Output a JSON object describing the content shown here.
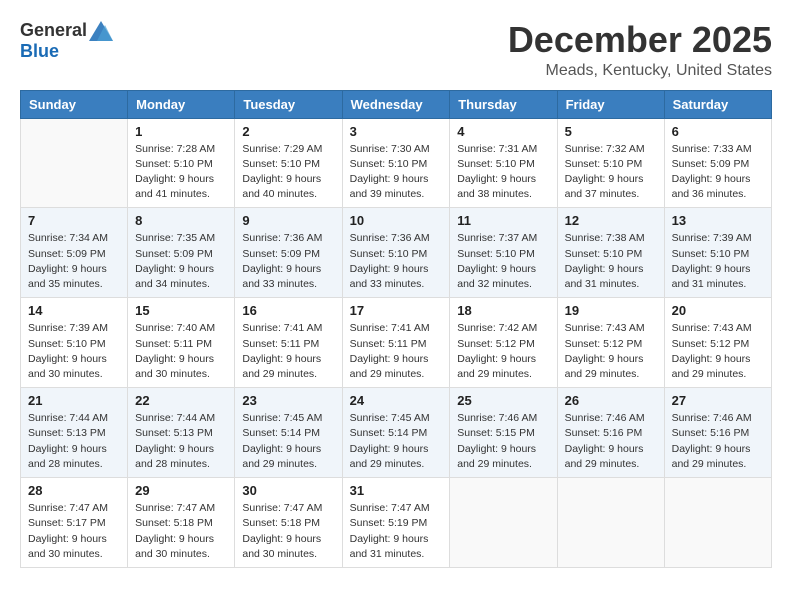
{
  "logo": {
    "general": "General",
    "blue": "Blue"
  },
  "title": {
    "month": "December 2025",
    "location": "Meads, Kentucky, United States"
  },
  "weekdays": [
    "Sunday",
    "Monday",
    "Tuesday",
    "Wednesday",
    "Thursday",
    "Friday",
    "Saturday"
  ],
  "weeks": [
    [
      {
        "day": "",
        "info": ""
      },
      {
        "day": "1",
        "info": "Sunrise: 7:28 AM\nSunset: 5:10 PM\nDaylight: 9 hours\nand 41 minutes."
      },
      {
        "day": "2",
        "info": "Sunrise: 7:29 AM\nSunset: 5:10 PM\nDaylight: 9 hours\nand 40 minutes."
      },
      {
        "day": "3",
        "info": "Sunrise: 7:30 AM\nSunset: 5:10 PM\nDaylight: 9 hours\nand 39 minutes."
      },
      {
        "day": "4",
        "info": "Sunrise: 7:31 AM\nSunset: 5:10 PM\nDaylight: 9 hours\nand 38 minutes."
      },
      {
        "day": "5",
        "info": "Sunrise: 7:32 AM\nSunset: 5:10 PM\nDaylight: 9 hours\nand 37 minutes."
      },
      {
        "day": "6",
        "info": "Sunrise: 7:33 AM\nSunset: 5:09 PM\nDaylight: 9 hours\nand 36 minutes."
      }
    ],
    [
      {
        "day": "7",
        "info": "Sunrise: 7:34 AM\nSunset: 5:09 PM\nDaylight: 9 hours\nand 35 minutes."
      },
      {
        "day": "8",
        "info": "Sunrise: 7:35 AM\nSunset: 5:09 PM\nDaylight: 9 hours\nand 34 minutes."
      },
      {
        "day": "9",
        "info": "Sunrise: 7:36 AM\nSunset: 5:09 PM\nDaylight: 9 hours\nand 33 minutes."
      },
      {
        "day": "10",
        "info": "Sunrise: 7:36 AM\nSunset: 5:10 PM\nDaylight: 9 hours\nand 33 minutes."
      },
      {
        "day": "11",
        "info": "Sunrise: 7:37 AM\nSunset: 5:10 PM\nDaylight: 9 hours\nand 32 minutes."
      },
      {
        "day": "12",
        "info": "Sunrise: 7:38 AM\nSunset: 5:10 PM\nDaylight: 9 hours\nand 31 minutes."
      },
      {
        "day": "13",
        "info": "Sunrise: 7:39 AM\nSunset: 5:10 PM\nDaylight: 9 hours\nand 31 minutes."
      }
    ],
    [
      {
        "day": "14",
        "info": "Sunrise: 7:39 AM\nSunset: 5:10 PM\nDaylight: 9 hours\nand 30 minutes."
      },
      {
        "day": "15",
        "info": "Sunrise: 7:40 AM\nSunset: 5:11 PM\nDaylight: 9 hours\nand 30 minutes."
      },
      {
        "day": "16",
        "info": "Sunrise: 7:41 AM\nSunset: 5:11 PM\nDaylight: 9 hours\nand 29 minutes."
      },
      {
        "day": "17",
        "info": "Sunrise: 7:41 AM\nSunset: 5:11 PM\nDaylight: 9 hours\nand 29 minutes."
      },
      {
        "day": "18",
        "info": "Sunrise: 7:42 AM\nSunset: 5:12 PM\nDaylight: 9 hours\nand 29 minutes."
      },
      {
        "day": "19",
        "info": "Sunrise: 7:43 AM\nSunset: 5:12 PM\nDaylight: 9 hours\nand 29 minutes."
      },
      {
        "day": "20",
        "info": "Sunrise: 7:43 AM\nSunset: 5:12 PM\nDaylight: 9 hours\nand 29 minutes."
      }
    ],
    [
      {
        "day": "21",
        "info": "Sunrise: 7:44 AM\nSunset: 5:13 PM\nDaylight: 9 hours\nand 28 minutes."
      },
      {
        "day": "22",
        "info": "Sunrise: 7:44 AM\nSunset: 5:13 PM\nDaylight: 9 hours\nand 28 minutes."
      },
      {
        "day": "23",
        "info": "Sunrise: 7:45 AM\nSunset: 5:14 PM\nDaylight: 9 hours\nand 29 minutes."
      },
      {
        "day": "24",
        "info": "Sunrise: 7:45 AM\nSunset: 5:14 PM\nDaylight: 9 hours\nand 29 minutes."
      },
      {
        "day": "25",
        "info": "Sunrise: 7:46 AM\nSunset: 5:15 PM\nDaylight: 9 hours\nand 29 minutes."
      },
      {
        "day": "26",
        "info": "Sunrise: 7:46 AM\nSunset: 5:16 PM\nDaylight: 9 hours\nand 29 minutes."
      },
      {
        "day": "27",
        "info": "Sunrise: 7:46 AM\nSunset: 5:16 PM\nDaylight: 9 hours\nand 29 minutes."
      }
    ],
    [
      {
        "day": "28",
        "info": "Sunrise: 7:47 AM\nSunset: 5:17 PM\nDaylight: 9 hours\nand 30 minutes."
      },
      {
        "day": "29",
        "info": "Sunrise: 7:47 AM\nSunset: 5:18 PM\nDaylight: 9 hours\nand 30 minutes."
      },
      {
        "day": "30",
        "info": "Sunrise: 7:47 AM\nSunset: 5:18 PM\nDaylight: 9 hours\nand 30 minutes."
      },
      {
        "day": "31",
        "info": "Sunrise: 7:47 AM\nSunset: 5:19 PM\nDaylight: 9 hours\nand 31 minutes."
      },
      {
        "day": "",
        "info": ""
      },
      {
        "day": "",
        "info": ""
      },
      {
        "day": "",
        "info": ""
      }
    ]
  ]
}
